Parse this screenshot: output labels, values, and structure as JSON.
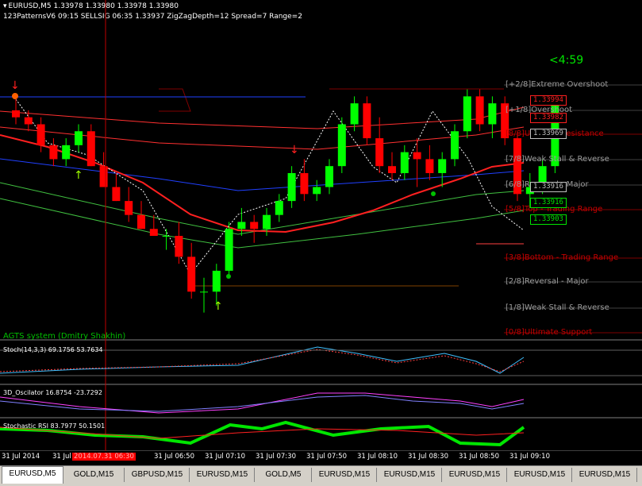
{
  "chart_data": {
    "type": "candlestick",
    "symbol": "EURUSD",
    "timeframe": "M5",
    "ohlc_header": "EURUSD,M5  1.33978 1.33980 1.33978 1.33980",
    "indicator_header": "123PatternsV6  09:15  SELLSIG  06:35  1.33937  ZigZagDepth=12  Spread=7  Range=2",
    "candles": [
      {
        "o": 1.3397,
        "h": 1.3399,
        "l": 1.3395,
        "c": 1.3396
      },
      {
        "o": 1.3396,
        "h": 1.3397,
        "l": 1.3394,
        "c": 1.3395
      },
      {
        "o": 1.3395,
        "h": 1.3396,
        "l": 1.3391,
        "c": 1.3392
      },
      {
        "o": 1.3392,
        "h": 1.3393,
        "l": 1.3389,
        "c": 1.339
      },
      {
        "o": 1.339,
        "h": 1.3393,
        "l": 1.3389,
        "c": 1.3392
      },
      {
        "o": 1.3392,
        "h": 1.3395,
        "l": 1.3391,
        "c": 1.3394
      },
      {
        "o": 1.3394,
        "h": 1.3395,
        "l": 1.3389,
        "c": 1.3389
      },
      {
        "o": 1.3389,
        "h": 1.3391,
        "l": 1.3386,
        "c": 1.3386
      },
      {
        "o": 1.3386,
        "h": 1.3388,
        "l": 1.3384,
        "c": 1.3384
      },
      {
        "o": 1.3384,
        "h": 1.3386,
        "l": 1.3381,
        "c": 1.3382
      },
      {
        "o": 1.3382,
        "h": 1.3384,
        "l": 1.338,
        "c": 1.338
      },
      {
        "o": 1.338,
        "h": 1.3382,
        "l": 1.3379,
        "c": 1.3379
      },
      {
        "o": 1.3379,
        "h": 1.338,
        "l": 1.3377,
        "c": 1.3379
      },
      {
        "o": 1.3379,
        "h": 1.3381,
        "l": 1.3375,
        "c": 1.3376
      },
      {
        "o": 1.3376,
        "h": 1.3378,
        "l": 1.337,
        "c": 1.3371
      },
      {
        "o": 1.3371,
        "h": 1.3373,
        "l": 1.3368,
        "c": 1.3371
      },
      {
        "o": 1.3371,
        "h": 1.3375,
        "l": 1.3369,
        "c": 1.3374
      },
      {
        "o": 1.3374,
        "h": 1.3381,
        "l": 1.3373,
        "c": 1.338
      },
      {
        "o": 1.338,
        "h": 1.3383,
        "l": 1.3379,
        "c": 1.3381
      },
      {
        "o": 1.3381,
        "h": 1.3382,
        "l": 1.3378,
        "c": 1.338
      },
      {
        "o": 1.338,
        "h": 1.3383,
        "l": 1.3379,
        "c": 1.3382
      },
      {
        "o": 1.3382,
        "h": 1.3385,
        "l": 1.3381,
        "c": 1.3384
      },
      {
        "o": 1.3384,
        "h": 1.3389,
        "l": 1.3383,
        "c": 1.3388
      },
      {
        "o": 1.3388,
        "h": 1.339,
        "l": 1.3384,
        "c": 1.3385
      },
      {
        "o": 1.3385,
        "h": 1.3387,
        "l": 1.3384,
        "c": 1.3386
      },
      {
        "o": 1.3386,
        "h": 1.339,
        "l": 1.3385,
        "c": 1.3389
      },
      {
        "o": 1.3389,
        "h": 1.3396,
        "l": 1.3388,
        "c": 1.3395
      },
      {
        "o": 1.3395,
        "h": 1.3399,
        "l": 1.3394,
        "c": 1.3398
      },
      {
        "o": 1.3398,
        "h": 1.3399,
        "l": 1.3392,
        "c": 1.3393
      },
      {
        "o": 1.3393,
        "h": 1.3396,
        "l": 1.3388,
        "c": 1.3389
      },
      {
        "o": 1.3389,
        "h": 1.3391,
        "l": 1.3387,
        "c": 1.3388
      },
      {
        "o": 1.3388,
        "h": 1.3392,
        "l": 1.3387,
        "c": 1.3391
      },
      {
        "o": 1.3391,
        "h": 1.3393,
        "l": 1.3386,
        "c": 1.339
      },
      {
        "o": 1.339,
        "h": 1.3392,
        "l": 1.3387,
        "c": 1.3388
      },
      {
        "o": 1.3388,
        "h": 1.3391,
        "l": 1.3386,
        "c": 1.339
      },
      {
        "o": 1.339,
        "h": 1.3395,
        "l": 1.3389,
        "c": 1.3394
      },
      {
        "o": 1.3394,
        "h": 1.34,
        "l": 1.3393,
        "c": 1.3399
      },
      {
        "o": 1.3399,
        "h": 1.34,
        "l": 1.3394,
        "c": 1.3395
      },
      {
        "o": 1.3395,
        "h": 1.3399,
        "l": 1.3393,
        "c": 1.3398
      },
      {
        "o": 1.3398,
        "h": 1.3399,
        "l": 1.3392,
        "c": 1.3393
      },
      {
        "o": 1.3393,
        "h": 1.3394,
        "l": 1.3384,
        "c": 1.3385
      },
      {
        "o": 1.3385,
        "h": 1.3388,
        "l": 1.3383,
        "c": 1.3386
      },
      {
        "o": 1.3386,
        "h": 1.339,
        "l": 1.3385,
        "c": 1.3389
      },
      {
        "o": 1.3389,
        "h": 1.3398,
        "l": 1.3388,
        "c": 1.3398
      }
    ],
    "price_labels": [
      {
        "text": "1.33994",
        "color": "#ff2020"
      },
      {
        "text": "1.33982",
        "color": "#ff2020"
      },
      {
        "text": "1.33969",
        "color": "#c0c0c0"
      },
      {
        "text": "1.33916",
        "color": "#c0c0c0"
      },
      {
        "text": "1.33916",
        "color": "#00e600"
      },
      {
        "text": "1.33903",
        "color": "#00e600"
      }
    ],
    "murrey_levels": [
      {
        "text": "[+2/8]Extreme Overshoot",
        "color": "#9a9a9a"
      },
      {
        "text": "[+1/8]Overshoot",
        "color": "#9a9a9a"
      },
      {
        "text": "[8/8]Ultimate Resistance",
        "color": "#c00000"
      },
      {
        "text": "[7/8]Weak Stall & Reverse",
        "color": "#9a9a9a"
      },
      {
        "text": "[6/8]Reversal - Major",
        "color": "#9a9a9a"
      },
      {
        "text": "[5/8]Top - Trading Range",
        "color": "#c00000"
      },
      {
        "text": "[3/8]Bottom - Trading Range",
        "color": "#c00000"
      },
      {
        "text": "[2/8]Reversal - Major",
        "color": "#9a9a9a"
      },
      {
        "text": "[1/8]Weak Stall & Reverse",
        "color": "#9a9a9a"
      },
      {
        "text": "[0/8]Ultimate Support",
        "color": "#c00000"
      }
    ],
    "system_label": "AGTS system (Dmitry Shakhin)",
    "timer": "<4:59",
    "subpanes": [
      {
        "label": "Stoch(14,3,3) 69.1756 53.7634"
      },
      {
        "label": "3D_Oscilator 16.8754 -23.7292"
      },
      {
        "label": "Stochastic RSI 83.7977 50.1501"
      }
    ],
    "x_ticks": [
      "31 Jul 2014",
      "31 Jul",
      "31 Jul 06:50",
      "31 Jul 07:10",
      "31 Jul 07:30",
      "31 Jul 07:50",
      "31 Jul 08:10",
      "31 Jul 08:30",
      "31 Jul 08:50",
      "31 Jul 09:10"
    ],
    "x_highlight": "2014.07.31 06:30",
    "colors": {
      "bull": "#00ff00",
      "bear": "#ff0000",
      "ema": "#ff2020",
      "blue_ma": "#2060ff",
      "bg": "#000000"
    }
  },
  "tabs": [
    "EURUSD,M5",
    "GOLD,M15",
    "GBPUSD,M15",
    "EURUSD,M15",
    "GOLD,M5",
    "EURUSD,M15",
    "EURUSD,M15",
    "EURUSD,M15",
    "EURUSD,M15",
    "EURUSD,M15"
  ]
}
